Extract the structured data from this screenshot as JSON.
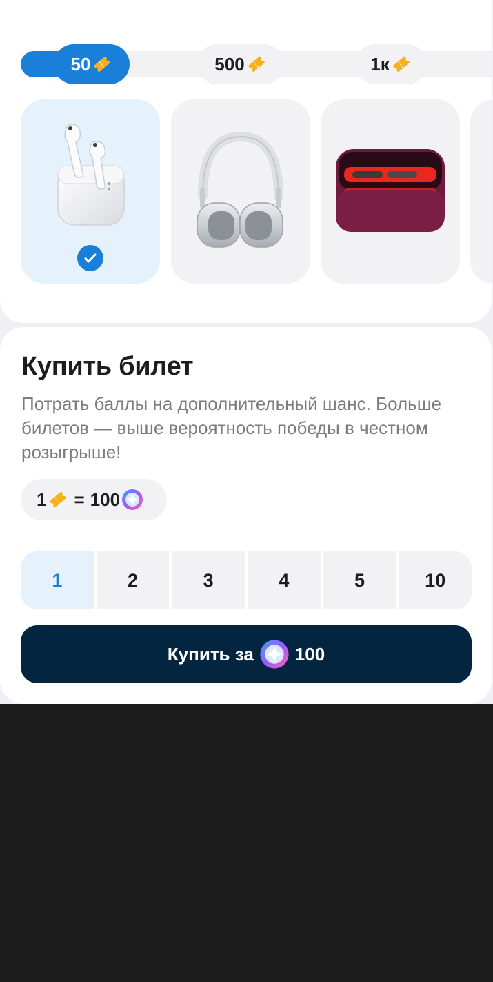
{
  "tiers": [
    {
      "label": "50",
      "active": true
    },
    {
      "label": "500",
      "active": false
    },
    {
      "label": "1к",
      "active": false
    }
  ],
  "products": [
    {
      "name": "airpods-pro",
      "selected": true
    },
    {
      "name": "airpods-max",
      "selected": false
    },
    {
      "name": "dyson-airwrap",
      "selected": false
    }
  ],
  "buy": {
    "title": "Купить билет",
    "description": "Потрать баллы на дополнительный шанс. Больше билетов — выше вероятность победы в честном розыгрыше!",
    "rate": {
      "tickets": "1",
      "equals": "=",
      "points": "100"
    },
    "quantities": [
      "1",
      "2",
      "3",
      "4",
      "5",
      "10"
    ],
    "selected_quantity": "1",
    "button": {
      "label": "Купить за",
      "amount": "100"
    }
  },
  "colors": {
    "accent": "#1a7fd8",
    "button_bg": "#042540",
    "ticket": "#f6b21c",
    "selected_bg": "#e6f2fb"
  }
}
